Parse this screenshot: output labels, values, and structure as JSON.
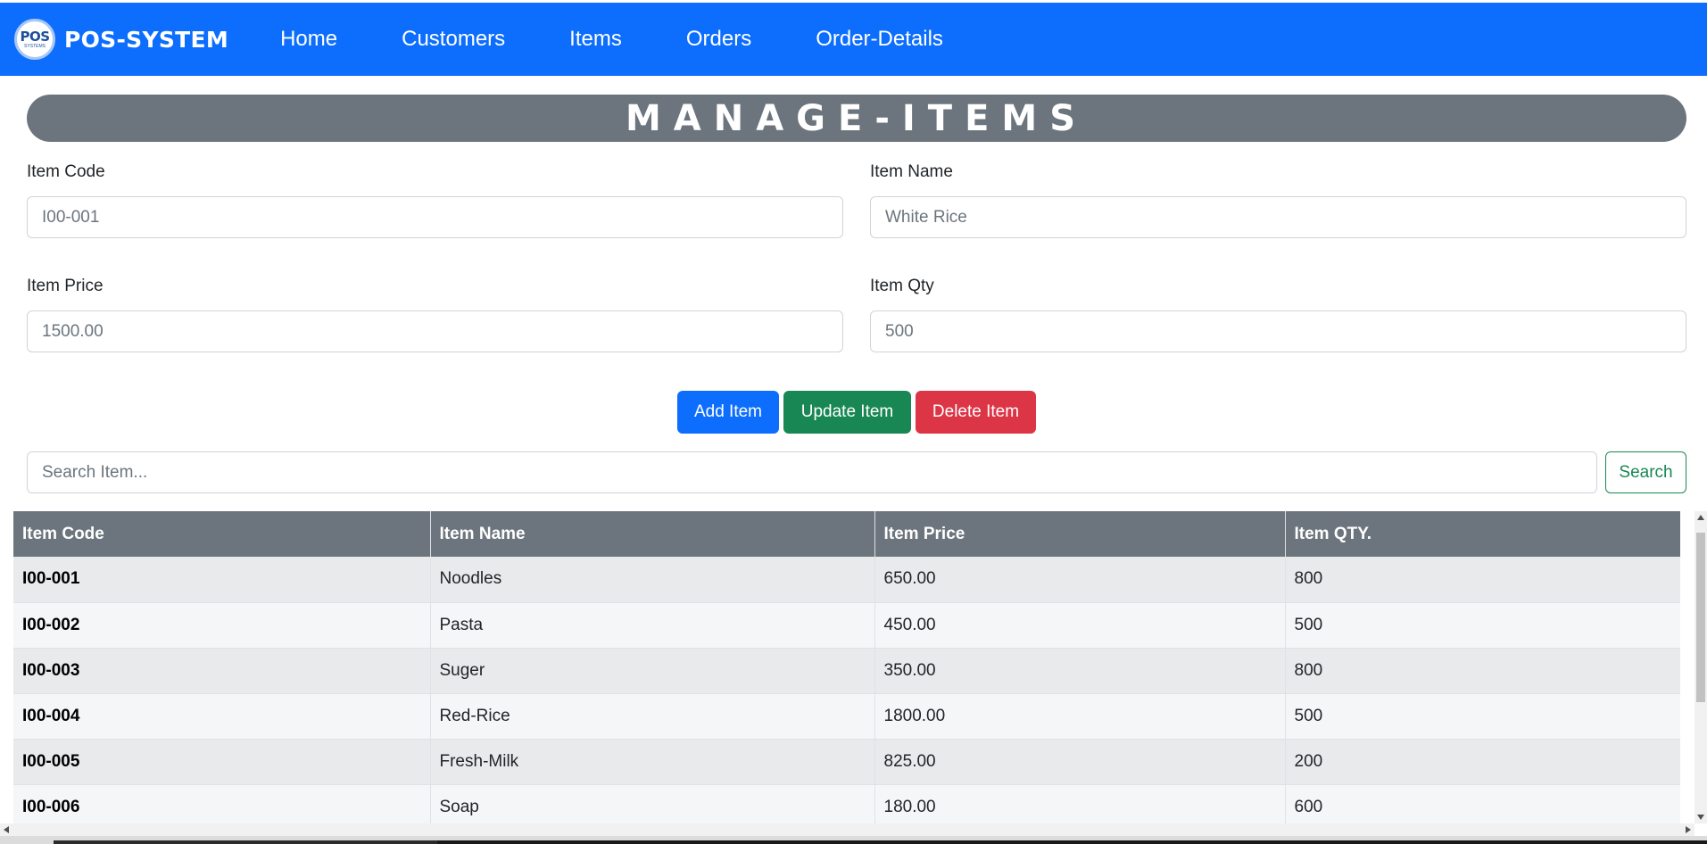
{
  "navbar": {
    "brand": "POS-SYSTEM",
    "logo_text": "POS",
    "logo_sub": "SYSTEMS",
    "links": [
      "Home",
      "Customers",
      "Items",
      "Orders",
      "Order-Details"
    ],
    "color": "#0d6efd"
  },
  "page_title": "MANAGE-ITEMS",
  "form": {
    "item_code": {
      "label": "Item Code",
      "placeholder": "I00-001"
    },
    "item_name": {
      "label": "Item Name",
      "placeholder": "White Rice"
    },
    "item_price": {
      "label": "Item Price",
      "placeholder": "1500.00"
    },
    "item_qty": {
      "label": "Item Qty",
      "placeholder": "500"
    }
  },
  "buttons": {
    "add": "Add Item",
    "update": "Update Item",
    "delete": "Delete Item"
  },
  "search": {
    "placeholder": "Search Item...",
    "button": "Search"
  },
  "table": {
    "headers": [
      "Item Code",
      "Item Name",
      "Item Price",
      "Item QTY."
    ],
    "rows": [
      [
        "I00-001",
        "Noodles",
        "650.00",
        "800"
      ],
      [
        "I00-002",
        "Pasta",
        "450.00",
        "500"
      ],
      [
        "I00-003",
        "Suger",
        "350.00",
        "800"
      ],
      [
        "I00-004",
        "Red-Rice",
        "1800.00",
        "500"
      ],
      [
        "I00-005",
        "Fresh-Milk",
        "825.00",
        "200"
      ],
      [
        "I00-006",
        "Soap",
        "180.00",
        "600"
      ]
    ]
  },
  "colors": {
    "primary": "#0d6efd",
    "success": "#198754",
    "danger": "#dc3545",
    "secondary": "#6c757d"
  }
}
